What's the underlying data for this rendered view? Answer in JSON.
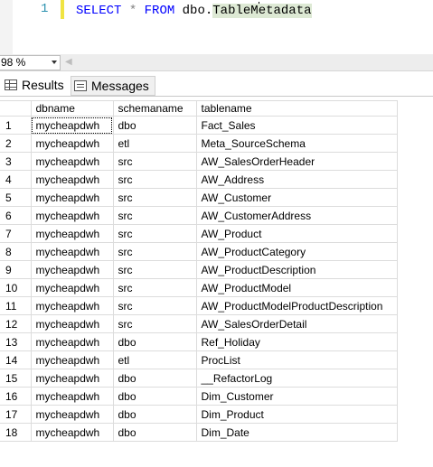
{
  "editor": {
    "line_number": "1",
    "tokens": {
      "select": "SELECT",
      "star": "*",
      "from": "FROM",
      "schema": "dbo.",
      "table_before_caret": "TableM",
      "table_after_caret": "etadata"
    }
  },
  "status": {
    "zoom": "98 %"
  },
  "tabs": {
    "results": "Results",
    "messages": "Messages"
  },
  "results": {
    "columns": [
      "dbname",
      "schemaname",
      "tablename"
    ],
    "rows": [
      {
        "n": "1",
        "dbname": "mycheapdwh",
        "schemaname": "dbo",
        "tablename": "Fact_Sales"
      },
      {
        "n": "2",
        "dbname": "mycheapdwh",
        "schemaname": "etl",
        "tablename": "Meta_SourceSchema"
      },
      {
        "n": "3",
        "dbname": "mycheapdwh",
        "schemaname": "src",
        "tablename": "AW_SalesOrderHeader"
      },
      {
        "n": "4",
        "dbname": "mycheapdwh",
        "schemaname": "src",
        "tablename": "AW_Address"
      },
      {
        "n": "5",
        "dbname": "mycheapdwh",
        "schemaname": "src",
        "tablename": "AW_Customer"
      },
      {
        "n": "6",
        "dbname": "mycheapdwh",
        "schemaname": "src",
        "tablename": "AW_CustomerAddress"
      },
      {
        "n": "7",
        "dbname": "mycheapdwh",
        "schemaname": "src",
        "tablename": "AW_Product"
      },
      {
        "n": "8",
        "dbname": "mycheapdwh",
        "schemaname": "src",
        "tablename": "AW_ProductCategory"
      },
      {
        "n": "9",
        "dbname": "mycheapdwh",
        "schemaname": "src",
        "tablename": "AW_ProductDescription"
      },
      {
        "n": "10",
        "dbname": "mycheapdwh",
        "schemaname": "src",
        "tablename": "AW_ProductModel"
      },
      {
        "n": "11",
        "dbname": "mycheapdwh",
        "schemaname": "src",
        "tablename": "AW_ProductModelProductDescription"
      },
      {
        "n": "12",
        "dbname": "mycheapdwh",
        "schemaname": "src",
        "tablename": "AW_SalesOrderDetail"
      },
      {
        "n": "13",
        "dbname": "mycheapdwh",
        "schemaname": "dbo",
        "tablename": "Ref_Holiday"
      },
      {
        "n": "14",
        "dbname": "mycheapdwh",
        "schemaname": "etl",
        "tablename": "ProcList"
      },
      {
        "n": "15",
        "dbname": "mycheapdwh",
        "schemaname": "dbo",
        "tablename": "__RefactorLog"
      },
      {
        "n": "16",
        "dbname": "mycheapdwh",
        "schemaname": "dbo",
        "tablename": "Dim_Customer"
      },
      {
        "n": "17",
        "dbname": "mycheapdwh",
        "schemaname": "dbo",
        "tablename": "Dim_Product"
      },
      {
        "n": "18",
        "dbname": "mycheapdwh",
        "schemaname": "dbo",
        "tablename": "Dim_Date"
      }
    ]
  },
  "colors": {
    "keyword": "#0000ff",
    "line_number": "#2b91af",
    "change_bar": "#f0e442"
  },
  "icons": {
    "results_tab": "grid-icon",
    "messages_tab": "messages-icon",
    "zoom_dropdown": "chevron-down-icon",
    "scroll_left": "scroll-left-icon"
  }
}
